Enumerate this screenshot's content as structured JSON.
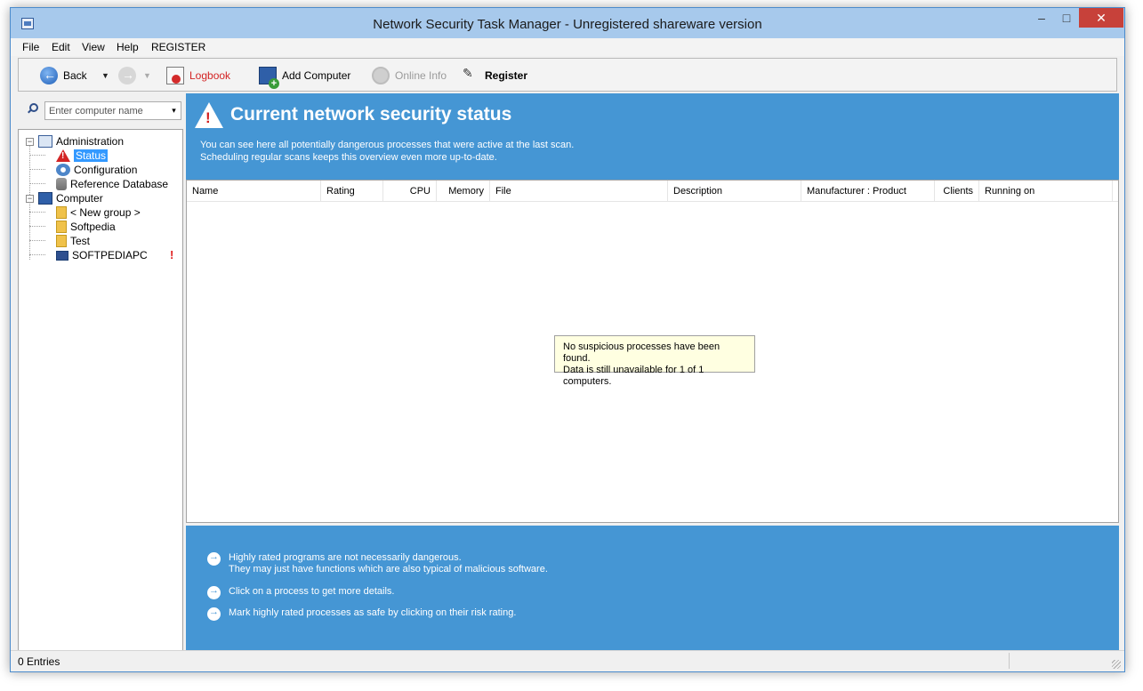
{
  "window": {
    "title": "Network Security Task Manager - Unregistered shareware version",
    "controls": {
      "minimize": "–",
      "maximize": "□",
      "close": "✕"
    }
  },
  "menu": [
    "File",
    "Edit",
    "View",
    "Help",
    "REGISTER"
  ],
  "toolbar": {
    "back": "Back",
    "logbook": "Logbook",
    "add_computer": "Add Computer",
    "online_info": "Online Info",
    "register": "Register",
    "dropdown_glyph": "▼",
    "accent_colors": {
      "logbook": "#d32424",
      "disabled": "#9a9a9a"
    }
  },
  "search": {
    "placeholder": "Enter computer name",
    "dropdown_glyph": "▾"
  },
  "tree": {
    "expand_glyph": "−",
    "administration": "Administration",
    "status": "Status",
    "configuration": "Configuration",
    "reference_database": "Reference Database",
    "computer": "Computer",
    "new_group": "< New group >",
    "softpedia": "Softpedia",
    "test": "Test",
    "softpediapc": "SOFTPEDIAPC",
    "alert_mark": "!"
  },
  "header": {
    "title": "Current network security status",
    "line1": "You can see here all potentially dangerous processes that were active at the last scan.",
    "line2": "Scheduling regular scans keeps this overview even more up-to-date.",
    "color": "#4596d4"
  },
  "table": {
    "columns": [
      "Name",
      "Rating",
      "CPU",
      "Memory",
      "File",
      "Description",
      "Manufacturer : Product",
      "Clients",
      "Running on"
    ]
  },
  "empty_note": {
    "line1": "No suspicious processes have been found.",
    "line2": "Data is still unavailable for 1 of 1 computers."
  },
  "tips": {
    "tip1_line1": "Highly rated programs are not necessarily dangerous.",
    "tip1_line2": "They may just have functions which are also typical of malicious software.",
    "tip2": "Click on a process to get more details.",
    "tip3": "Mark highly rated processes as safe by clicking on their risk rating."
  },
  "status": {
    "entries": "0 Entries"
  }
}
